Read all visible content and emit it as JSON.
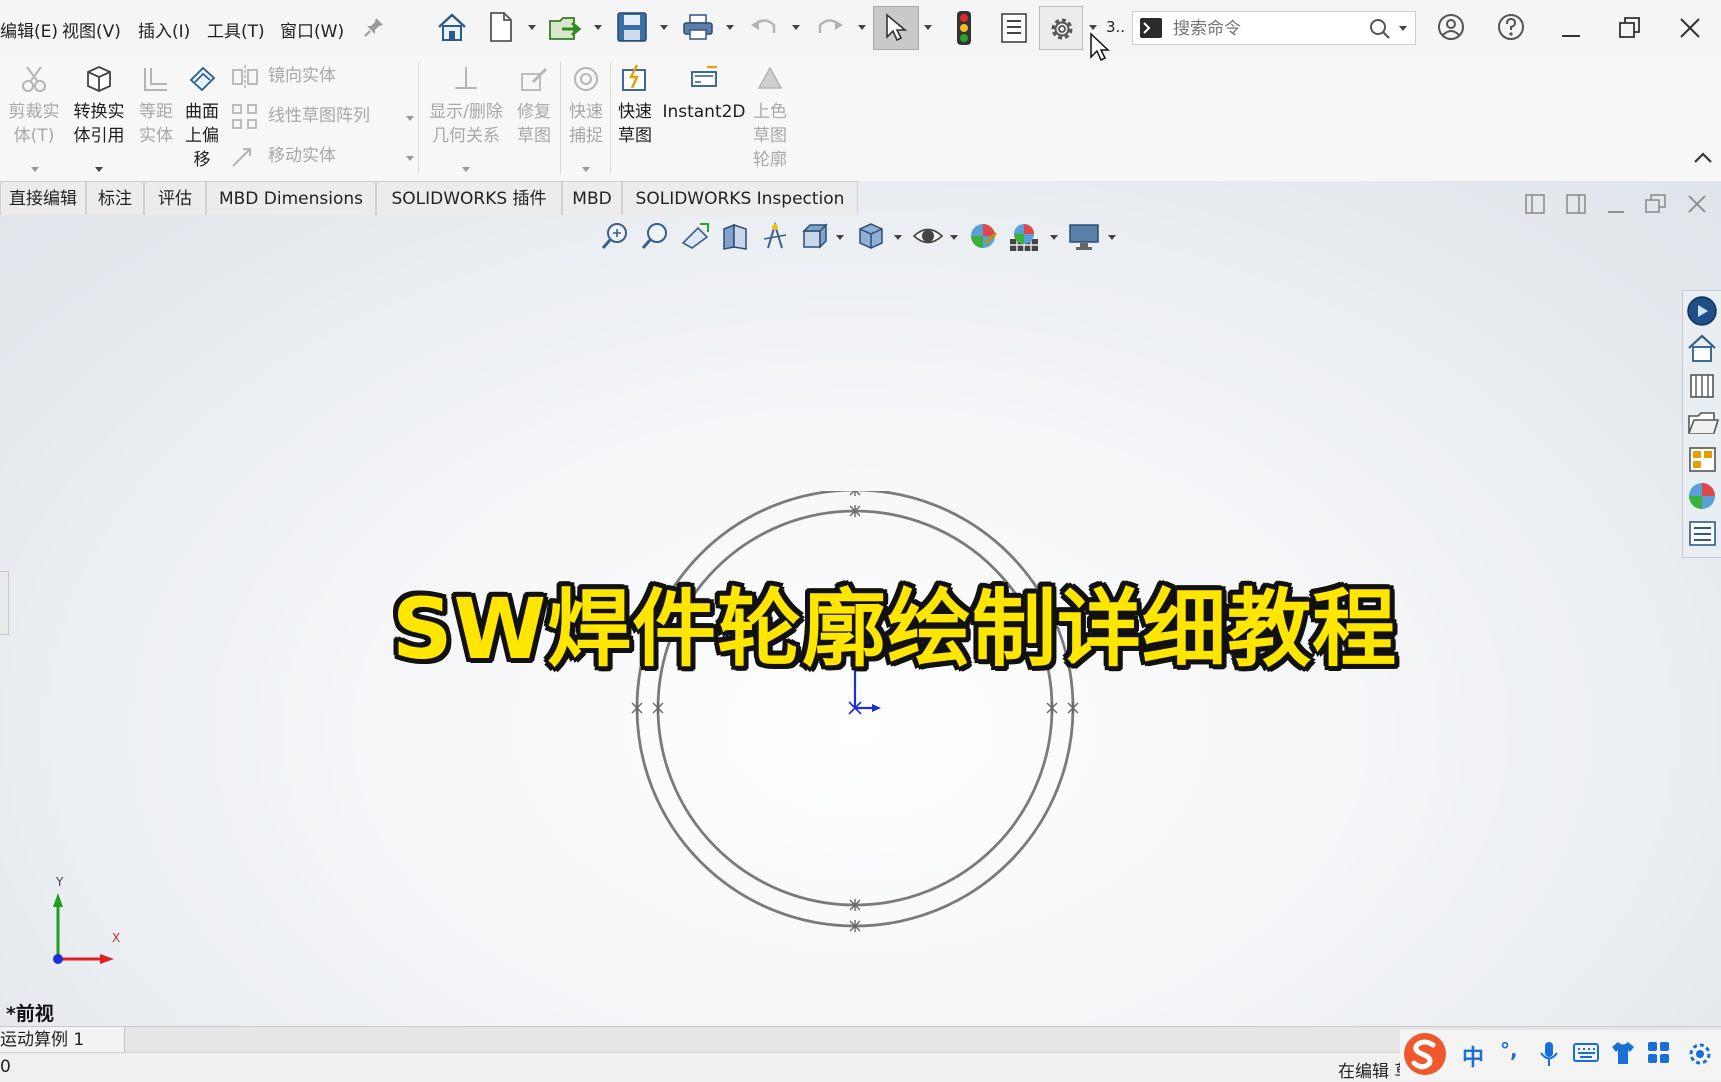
{
  "menu": {
    "items": [
      "编辑(E)",
      "视图(V)",
      "插入(I)",
      "工具(T)",
      "窗口(W)"
    ]
  },
  "toolbar": {
    "counter_label": "3..",
    "search_placeholder": "搜索命令"
  },
  "ribbon": {
    "trim": "剪裁实\n体(T)",
    "convert_line1": "转换实",
    "convert_line2": "体引用",
    "offset_line1": "等距",
    "offset_line2": "实体",
    "surface_line1": "曲面",
    "surface_line2": "上偏",
    "surface_line3": "移",
    "mirror": "镜向实体",
    "linear_pattern": "线性草图阵列",
    "move": "移动实体",
    "relations_line1": "显示/删除",
    "relations_line2": "几何关系",
    "repair_line1": "修复",
    "repair_line2": "草图",
    "snap_line1": "快速",
    "snap_line2": "捕捉",
    "rapid_line1": "快速",
    "rapid_line2": "草图",
    "instant2d": "Instant2D",
    "shaded_line1": "上色",
    "shaded_line2": "草图",
    "shaded_line3": "轮廓"
  },
  "tabs": [
    "直接编辑",
    "标注",
    "评估",
    "MBD Dimensions",
    "SOLIDWORKS 插件",
    "MBD",
    "SOLIDWORKS Inspection"
  ],
  "viewport": {
    "banner": "SW焊件轮廓绘制详细教程",
    "view_name": "*前视",
    "axis_x": "X",
    "axis_y": "Y"
  },
  "bottom": {
    "motion_tab": "运动算例 1",
    "status_left": "0",
    "status_right": "在编辑 草"
  },
  "ime": {
    "lang": "中",
    "punct": "°,"
  },
  "colors": {
    "banner_fill": "#ffe600",
    "banner_outline": "#111111",
    "sketch_line": "#7a7a7a",
    "origin_blue": "#1a2fd6",
    "axis_red": "#e02020",
    "axis_green": "#1aa01a"
  }
}
